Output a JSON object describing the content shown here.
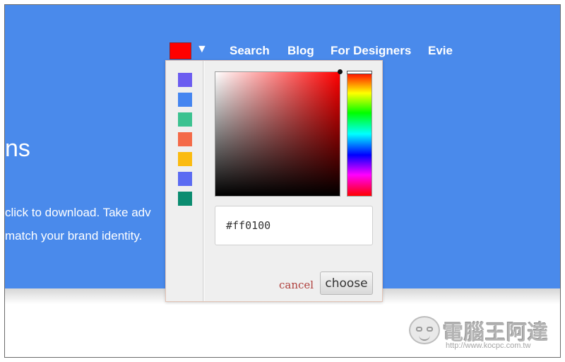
{
  "nav": {
    "current_color": "#ff0000",
    "dropdown_arrow": "▼",
    "links": [
      "Search",
      "Blog",
      "For Designers",
      "Evie"
    ]
  },
  "hero": {
    "title_fragment": "ns",
    "text_lines": [
      "click to download. Take adv",
      "match your brand identity."
    ]
  },
  "picker": {
    "swatches": [
      "#6b5cf0",
      "#4585f0",
      "#3cc290",
      "#f46a48",
      "#fbbb10",
      "#5b6bf2",
      "#0b8c70"
    ],
    "hue_color": "#ff0000",
    "hex_value": "#ff0100",
    "cancel_label": "cancel",
    "choose_label": "choose"
  },
  "watermark": {
    "title": "電腦王阿達",
    "url": "http://www.kocpc.com.tw"
  }
}
